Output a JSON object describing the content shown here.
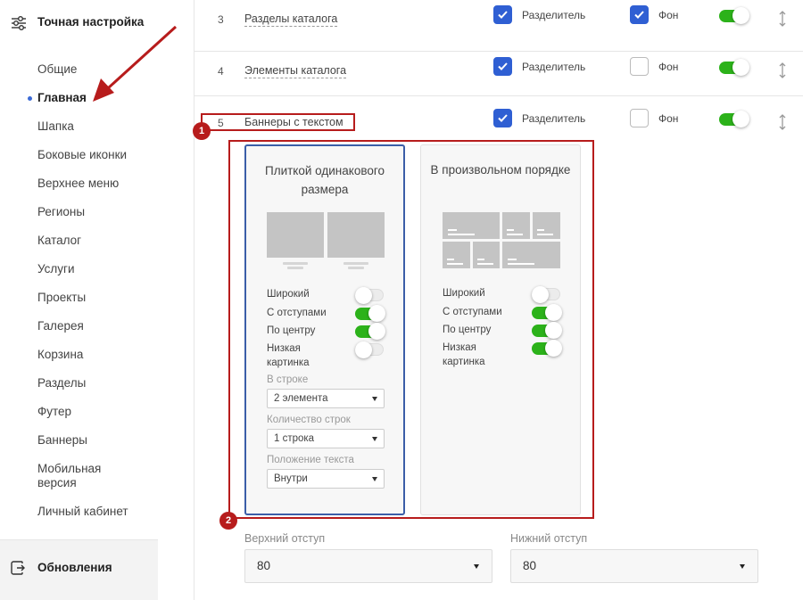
{
  "sidebar": {
    "title": "Точная настройка",
    "items": [
      {
        "label": "Общие"
      },
      {
        "label": "Главная"
      },
      {
        "label": "Шапка"
      },
      {
        "label": "Боковые иконки"
      },
      {
        "label": "Верхнее меню"
      },
      {
        "label": "Регионы"
      },
      {
        "label": "Каталог"
      },
      {
        "label": "Услуги"
      },
      {
        "label": "Проекты"
      },
      {
        "label": "Галерея"
      },
      {
        "label": "Корзина"
      },
      {
        "label": "Разделы"
      },
      {
        "label": "Футер"
      },
      {
        "label": "Баннеры"
      },
      {
        "label": "Мобильная версия"
      },
      {
        "label": "Личный кабинет"
      }
    ],
    "active_item": "Главная",
    "footer_label": "Обновления"
  },
  "rows": [
    {
      "num": "3",
      "name": "Разделы каталога",
      "divider_label": "Разделитель",
      "divider_checked": true,
      "bg_label": "Фон",
      "bg_checked": true,
      "enabled": true
    },
    {
      "num": "4",
      "name": "Элементы каталога",
      "divider_label": "Разделитель",
      "divider_checked": true,
      "bg_label": "Фон",
      "bg_checked": false,
      "enabled": true
    },
    {
      "num": "5",
      "name": "Баннеры с текстом",
      "divider_label": "Разделитель",
      "divider_checked": true,
      "bg_label": "Фон",
      "bg_checked": false,
      "enabled": true
    }
  ],
  "cards": [
    {
      "title": "Плиткой одинакового размера",
      "selected": true,
      "options": [
        {
          "label": "Широкий",
          "on": false
        },
        {
          "label": "С отступами",
          "on": true
        },
        {
          "label": "По центру",
          "on": true
        },
        {
          "label": "Низкая картинка",
          "on": false
        }
      ],
      "selects": [
        {
          "label": "В строке",
          "value": "2 элемента"
        },
        {
          "label": "Количество строк",
          "value": "1 строка"
        },
        {
          "label": "Положение текста",
          "value": "Внутри"
        }
      ]
    },
    {
      "title": "В произвольном порядке",
      "selected": false,
      "options": [
        {
          "label": "Широкий",
          "on": false
        },
        {
          "label": "С отступами",
          "on": true
        },
        {
          "label": "По центру",
          "on": true
        },
        {
          "label": "Низкая картинка",
          "on": true
        }
      ]
    }
  ],
  "badges": [
    "1",
    "2"
  ],
  "padding": {
    "top_label": "Верхний отступ",
    "top_value": "80",
    "bottom_label": "Нижний отступ",
    "bottom_value": "80"
  },
  "colors": {
    "accent_blue": "#2f5fd3",
    "toggle_green": "#2cb21a",
    "highlight_red": "#b71c1c"
  }
}
